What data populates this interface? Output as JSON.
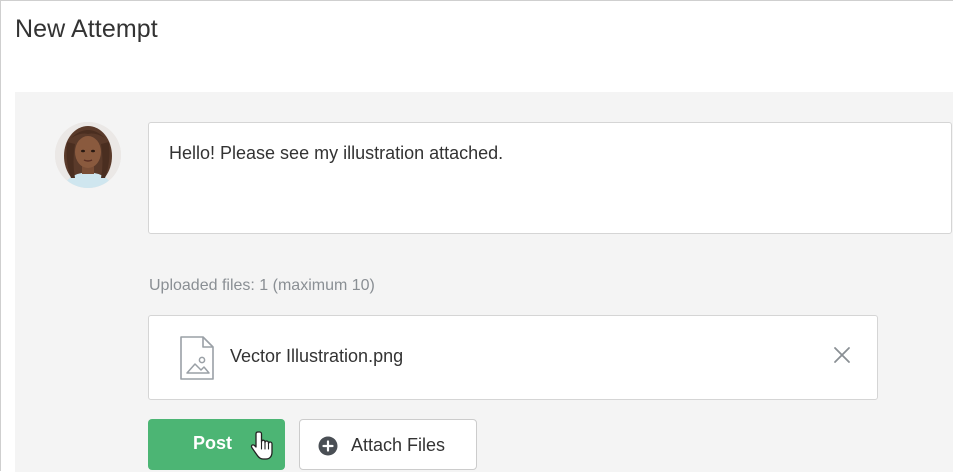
{
  "page": {
    "title": "New Attempt"
  },
  "composer": {
    "message": "Hello! Please see my illustration attached.",
    "avatar_icon": "user-avatar-photo"
  },
  "uploads": {
    "count_text": "Uploaded files: 1 (maximum 10)",
    "files": [
      {
        "name": "Vector Illustration.png",
        "icon": "image-file-icon"
      }
    ],
    "remove_icon": "close-icon"
  },
  "actions": {
    "post_label": "Post",
    "attach_label": "Attach Files",
    "attach_icon": "plus-circle-icon"
  },
  "colors": {
    "accent_green": "#4cb574",
    "panel_bg": "#f4f4f4",
    "muted_text": "#8a8f94"
  }
}
